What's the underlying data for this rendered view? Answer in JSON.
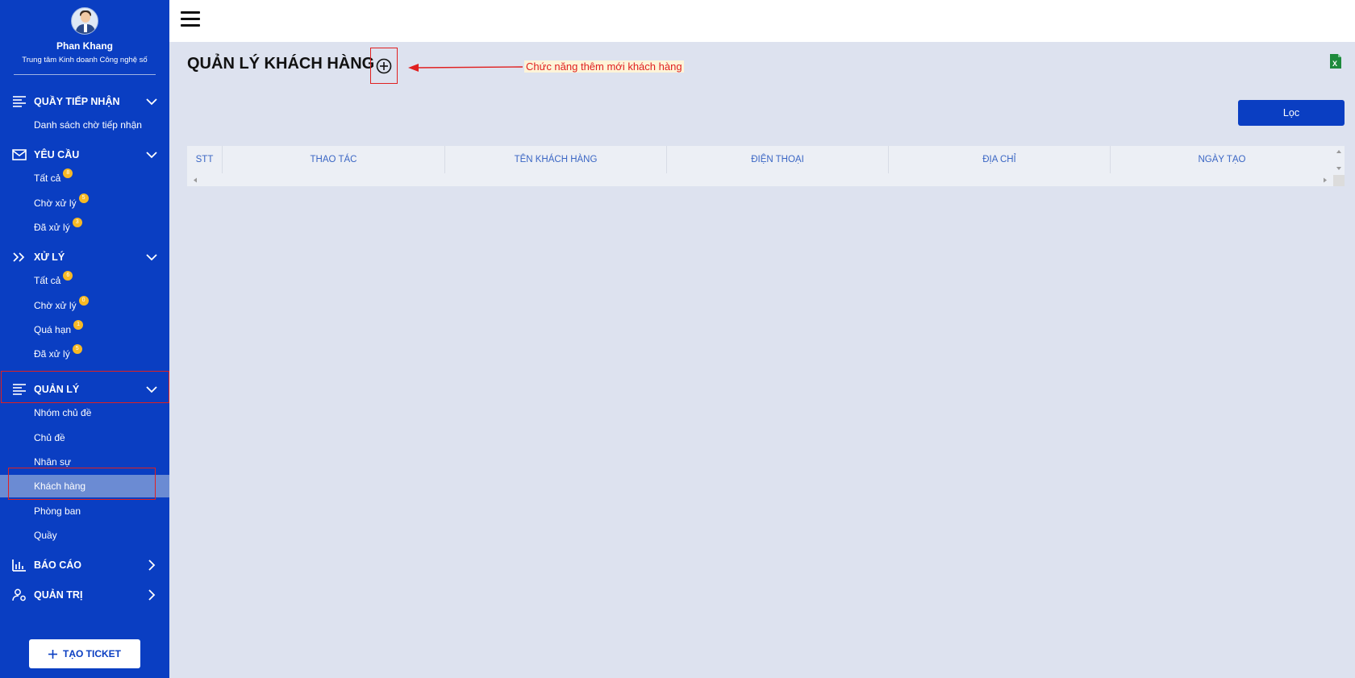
{
  "profile": {
    "name": "Phan Khang",
    "department": "Trung tâm Kinh doanh Công nghệ số"
  },
  "sidebar": {
    "reception": {
      "label": "QUẦY TIẾP NHẬN",
      "items": [
        {
          "label": "Danh sách chờ tiếp nhận"
        }
      ]
    },
    "requests": {
      "label": "YÊU CẦU",
      "items": [
        {
          "label": "Tất cả",
          "badge": "8"
        },
        {
          "label": "Chờ xử lý",
          "badge": "5"
        },
        {
          "label": "Đã xử lý",
          "badge": "3"
        }
      ]
    },
    "processing": {
      "label": "XỬ LÝ",
      "items": [
        {
          "label": "Tất cả",
          "badge": "6"
        },
        {
          "label": "Chờ xử lý",
          "badge": "0"
        },
        {
          "label": "Quá hạn",
          "badge": "1"
        },
        {
          "label": "Đã xử lý",
          "badge": "5"
        }
      ]
    },
    "management": {
      "label": "QUẢN LÝ",
      "items": [
        {
          "label": "Nhóm chủ đề"
        },
        {
          "label": "Chủ đề"
        },
        {
          "label": "Nhân sự"
        },
        {
          "label": "Khách hàng"
        },
        {
          "label": "Phòng ban"
        },
        {
          "label": "Quầy"
        }
      ]
    },
    "reports": {
      "label": "BÁO CÁO"
    },
    "admin": {
      "label": "QUẢN TRỊ"
    },
    "create_ticket": "TẠO TICKET",
    "active_item": "Khách hàng"
  },
  "page": {
    "title": "QUẢN LÝ KHÁCH HÀNG",
    "annotation": "Chức năng thêm mới khách hàng",
    "filter_label": "Lọc"
  },
  "table": {
    "columns": [
      "STT",
      "THAO TÁC",
      "TÊN KHÁCH HÀNG",
      "ĐIỆN THOẠI",
      "ĐỊA CHỈ",
      "NGÀY TẠO"
    ],
    "rows": []
  },
  "colors": {
    "sidebar": "#0a3ec2",
    "active_item": "#6b8bd3",
    "badge": "#f7b924",
    "annotation": "#e02020",
    "header_text": "#3a66c4"
  },
  "icons": [
    "menu-icon",
    "add-circle-icon",
    "excel-icon",
    "list-icon",
    "mail-icon",
    "double-chevron-icon",
    "bar-chart-icon",
    "user-settings-icon",
    "plus-icon"
  ]
}
